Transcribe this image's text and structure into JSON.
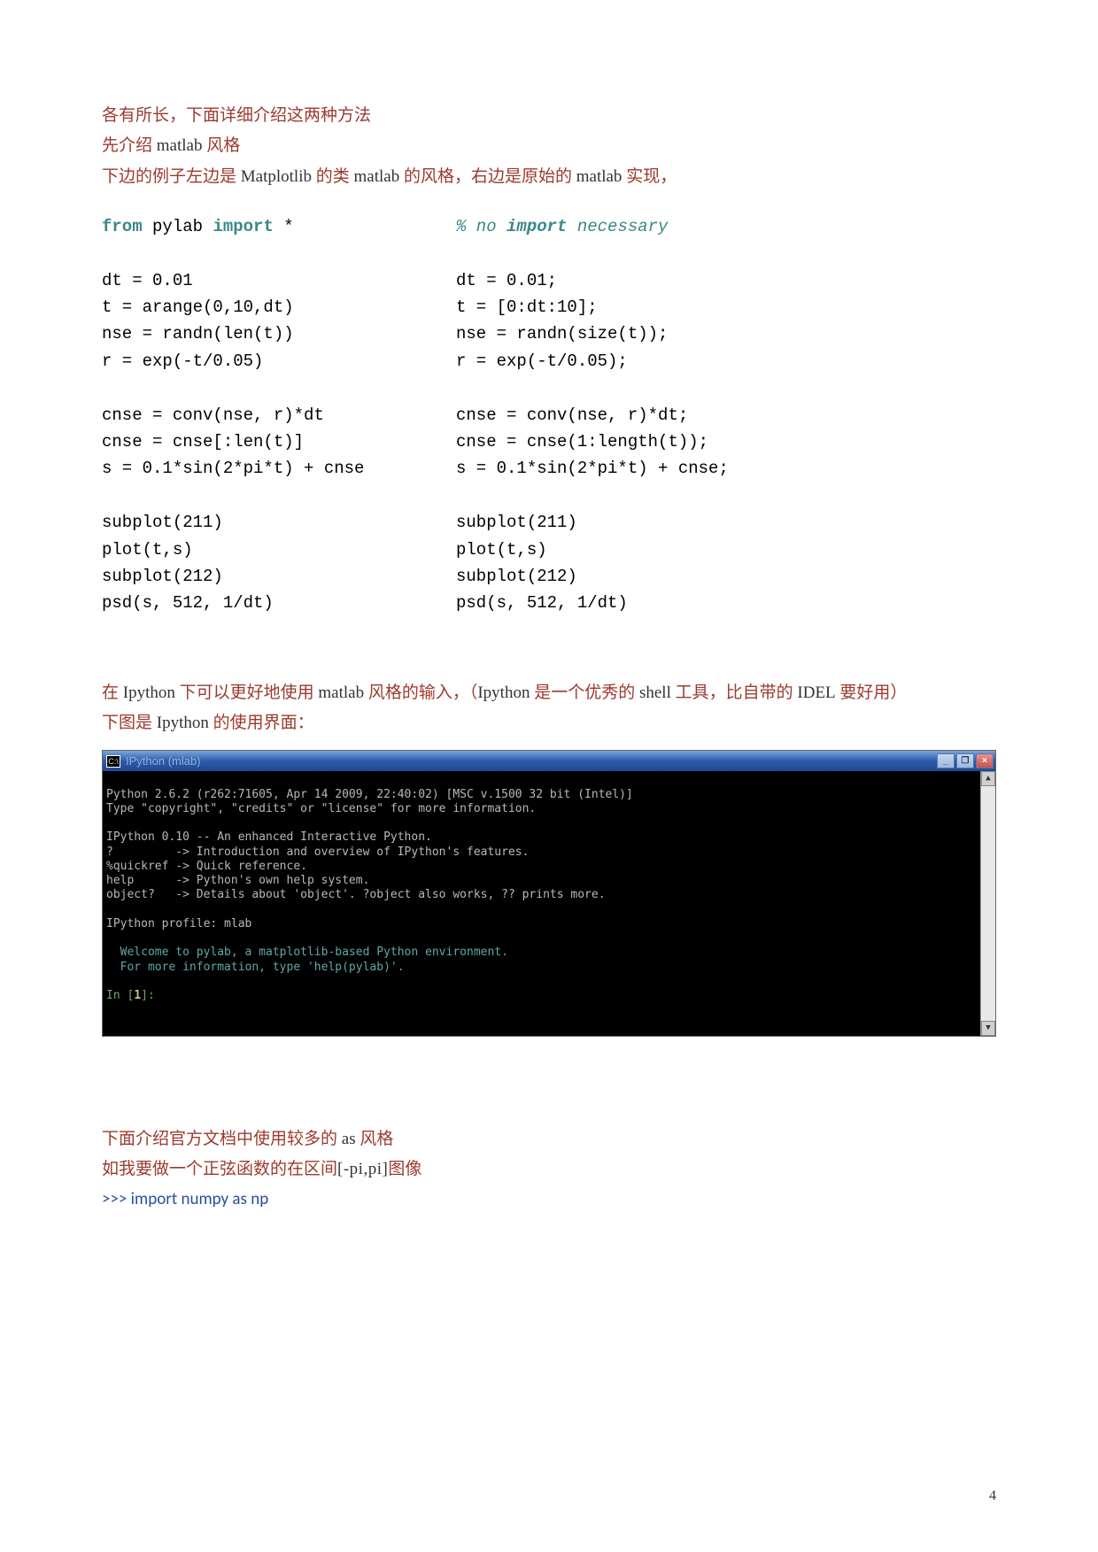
{
  "intro": {
    "line1": "各有所长，下面详细介绍这两种方法",
    "line2_a": "先介绍 ",
    "line2_b": "matlab",
    "line2_c": " 风格",
    "line3_a": "下边的例子左边是 ",
    "line3_b": "Matplotlib",
    "line3_c": " 的类 ",
    "line3_d": "matlab",
    "line3_e": " 的风格，右边是原始的 ",
    "line3_f": "matlab",
    "line3_g": " 实现，"
  },
  "code": {
    "left": {
      "l1a": "from",
      "l1b": " pylab ",
      "l1c": "import",
      "l1d": " *",
      "l2": "dt = 0.01",
      "l3": "t = arange(0,10,dt)",
      "l4": "nse = randn(len(t))",
      "l5": "r = exp(-t/0.05)",
      "l6": "cnse = conv(nse, r)*dt",
      "l7": "cnse = cnse[:len(t)]",
      "l8": "s = 0.1*sin(2*pi*t) + cnse",
      "l9": "subplot(211)",
      "l10": "plot(t,s)",
      "l11": "subplot(212)",
      "l12": "psd(s, 512, 1/dt)"
    },
    "right": {
      "l1a": "% no ",
      "l1b": "import",
      "l1c": " necessary",
      "l2": "dt = 0.01;",
      "l3": "t = [0:dt:10];",
      "l4": "nse = randn(size(t));",
      "l5": "r = exp(-t/0.05);",
      "l6": "cnse = conv(nse, r)*dt;",
      "l7": "cnse = cnse(1:length(t));",
      "l8": "s = 0.1*sin(2*pi*t) + cnse;",
      "l9": "subplot(211)",
      "l10": "plot(t,s)",
      "l11": "subplot(212)",
      "l12": "psd(s, 512, 1/dt)"
    }
  },
  "mid": {
    "m1_a": "在 ",
    "m1_b": "Ipython",
    "m1_c": " 下可以更好地使用 ",
    "m1_d": "matlab",
    "m1_e": " 风格的输入，（",
    "m1_f": "Ipython",
    "m1_g": " 是一个优秀的 ",
    "m1_h": "shell",
    "m1_i": " 工具，比自带的 ",
    "m1_j": "IDEL",
    "m1_k": " 要好用）",
    "m2_a": "下图是 ",
    "m2_b": "Ipython",
    "m2_c": " 的使用界面："
  },
  "terminal": {
    "title_prefix": "C:\\",
    "title": "IPython (mlab)",
    "btn_min": "_",
    "btn_max": "❐",
    "btn_close": "×",
    "line1": "Python 2.6.2 (r262:71605, Apr 14 2009, 22:40:02) [MSC v.1500 32 bit (Intel)]",
    "line2": "Type \"copyright\", \"credits\" or \"license\" for more information.",
    "line3": "IPython 0.10 -- An enhanced Interactive Python.",
    "line4": "?         -> Introduction and overview of IPython's features.",
    "line5": "%quickref -> Quick reference.",
    "line6": "help      -> Python's own help system.",
    "line7": "object?   -> Details about 'object'. ?object also works, ?? prints more.",
    "line8": "IPython profile: mlab",
    "line9": "  Welcome to pylab, a matplotlib-based Python environment.",
    "line10": "  For more information, type 'help(pylab)'.",
    "prompt_a": "In [",
    "prompt_b": "1",
    "prompt_c": "]:",
    "sb_up": "▲",
    "sb_dn": "▼"
  },
  "bottom": {
    "b1_a": "下面介绍官方文档中使用较多的 ",
    "b1_b": "as",
    "b1_c": " 风格",
    "b2_a": "如我要做一个正弦函数的在区间",
    "b2_b": "[-pi,pi]",
    "b2_c": "图像",
    "b3": ">>> import numpy as np"
  },
  "page": "4"
}
